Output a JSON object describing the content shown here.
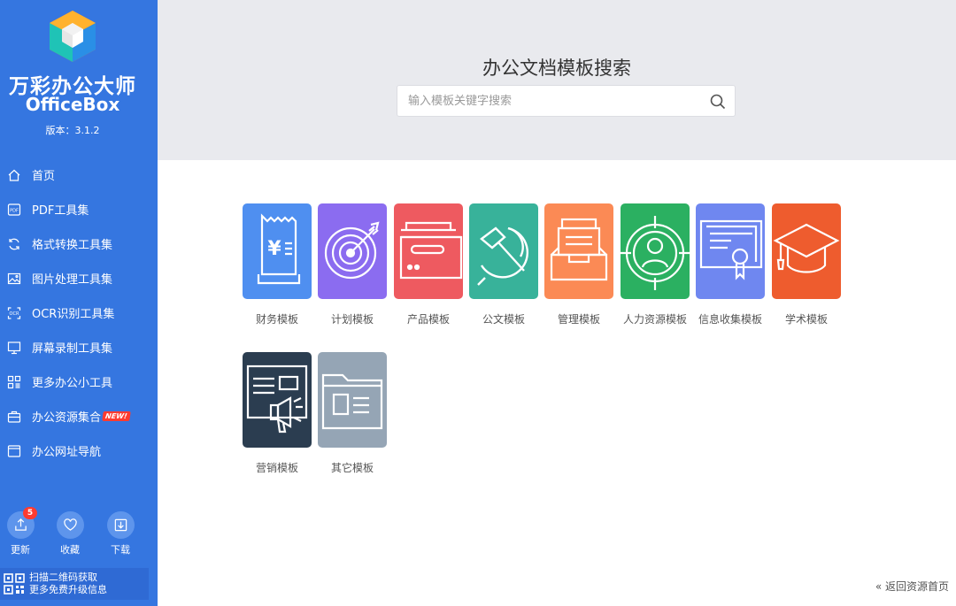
{
  "app": {
    "name_cn": "万彩办公大师",
    "name_en": "OfficeBox",
    "version": "版本：3.1.2"
  },
  "nav": [
    {
      "label": "首页",
      "icon": "home-icon"
    },
    {
      "label": "PDF工具集",
      "icon": "pdf-icon"
    },
    {
      "label": "格式转换工具集",
      "icon": "convert-icon"
    },
    {
      "label": "图片处理工具集",
      "icon": "image-icon"
    },
    {
      "label": "OCR识别工具集",
      "icon": "ocr-icon"
    },
    {
      "label": "屏幕录制工具集",
      "icon": "monitor-icon"
    },
    {
      "label": "更多办公小工具",
      "icon": "grid-icon"
    },
    {
      "label": "办公资源集合",
      "icon": "briefcase-icon",
      "badge": "NEW!"
    },
    {
      "label": "办公网址导航",
      "icon": "browser-icon"
    }
  ],
  "bottom_buttons": {
    "update": {
      "label": "更新",
      "count": "5"
    },
    "favorite": {
      "label": "收藏"
    },
    "download": {
      "label": "下载"
    }
  },
  "qr": {
    "line1": "扫描二维码获取",
    "line2": "更多免费升级信息"
  },
  "header": {
    "title": "办公文档模板搜索",
    "search_placeholder": "输入模板关键字搜索"
  },
  "templates": [
    {
      "label": "财务模板",
      "color": "#4f8ff0"
    },
    {
      "label": "计划模板",
      "color": "#8b6cf0"
    },
    {
      "label": "产品模板",
      "color": "#ee5a60"
    },
    {
      "label": "公文模板",
      "color": "#38b29a"
    },
    {
      "label": "管理模板",
      "color": "#fb8a55"
    },
    {
      "label": "人力资源模板",
      "color": "#2bb061"
    },
    {
      "label": "信息收集模板",
      "color": "#6f87f0"
    },
    {
      "label": "学术模板",
      "color": "#ee5c2e"
    },
    {
      "label": "营销模板",
      "color": "#2b3d50"
    },
    {
      "label": "其它模板",
      "color": "#95a5b5"
    }
  ],
  "footer": {
    "back_label": "« 返回资源首页"
  }
}
